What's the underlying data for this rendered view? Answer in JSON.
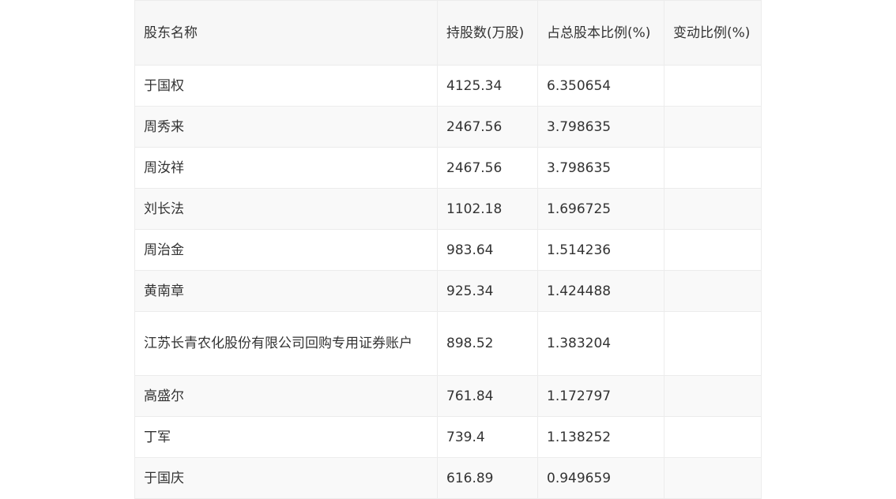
{
  "table": {
    "headers": [
      "股东名称",
      "持股数(万股)",
      "占总股本比例(%)",
      "变动比例(%)"
    ],
    "rows": [
      {
        "name": "于国权",
        "shares": "4125.34",
        "ratio": "6.350654",
        "change": ""
      },
      {
        "name": "周秀来",
        "shares": "2467.56",
        "ratio": "3.798635",
        "change": ""
      },
      {
        "name": "周汝祥",
        "shares": "2467.56",
        "ratio": "3.798635",
        "change": ""
      },
      {
        "name": "刘长法",
        "shares": "1102.18",
        "ratio": "1.696725",
        "change": ""
      },
      {
        "name": "周治金",
        "shares": "983.64",
        "ratio": "1.514236",
        "change": ""
      },
      {
        "name": "黄南章",
        "shares": "925.34",
        "ratio": "1.424488",
        "change": ""
      },
      {
        "name": "江苏长青农化股份有限公司回购专用证券账户",
        "shares": "898.52",
        "ratio": "1.383204",
        "change": ""
      },
      {
        "name": "高盛尔",
        "shares": "761.84",
        "ratio": "1.172797",
        "change": ""
      },
      {
        "name": "丁军",
        "shares": "739.4",
        "ratio": "1.138252",
        "change": ""
      },
      {
        "name": "于国庆",
        "shares": "616.89",
        "ratio": "0.949659",
        "change": ""
      }
    ]
  }
}
